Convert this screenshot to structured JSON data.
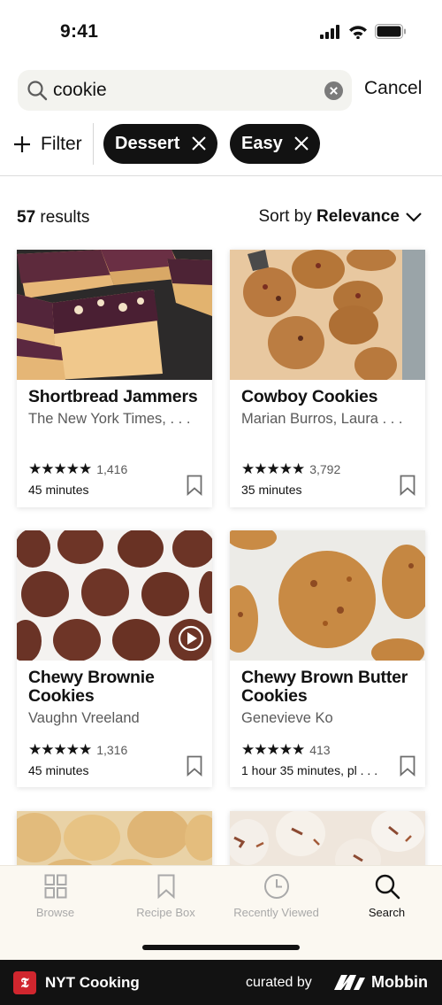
{
  "status_bar": {
    "time": "9:41"
  },
  "search": {
    "query": "cookie",
    "cancel_label": "Cancel"
  },
  "filters": {
    "filter_label": "Filter",
    "chips": [
      {
        "label": "Dessert"
      },
      {
        "label": "Easy"
      }
    ]
  },
  "results": {
    "count": "57",
    "count_suffix": " results",
    "sort_prefix": "Sort by ",
    "sort_value": "Relevance"
  },
  "recipes": [
    {
      "title": "Shortbread Jammers",
      "author": "The New York Times, . . .",
      "stars": "★★★★★",
      "rating_count": "1,416",
      "time": "45 minutes"
    },
    {
      "title": "Cowboy Cookies",
      "author": "Marian Burros, Laura . . .",
      "stars": "★★★★★",
      "rating_count": "3,792",
      "time": "35 minutes"
    },
    {
      "title": "Chewy Brownie Cookies",
      "author": "Vaughn Vreeland",
      "stars": "★★★★★",
      "rating_count": "1,316",
      "time": "45 minutes"
    },
    {
      "title": "Chewy Brown Butter Cookies",
      "author": "Genevieve Ko",
      "stars": "★★★★★",
      "rating_count": "413",
      "time": "1 hour 35 minutes, pl . . ."
    }
  ],
  "tab_bar": {
    "tabs": [
      {
        "label": "Browse",
        "icon": "grid-icon"
      },
      {
        "label": "Recipe Box",
        "icon": "bookmark-icon"
      },
      {
        "label": "Recently Viewed",
        "icon": "clock-icon"
      },
      {
        "label": "Search",
        "icon": "search-icon"
      }
    ],
    "active": "Search"
  },
  "footer": {
    "app_name": "NYT Cooking",
    "curated_by": "curated by",
    "brand": "Mobbin"
  },
  "colors": {
    "chip_bg": "#121212",
    "search_bg": "#f3f3ef",
    "tab_bar_bg": "#fbf8f1",
    "nyt_red": "#d0262e"
  }
}
